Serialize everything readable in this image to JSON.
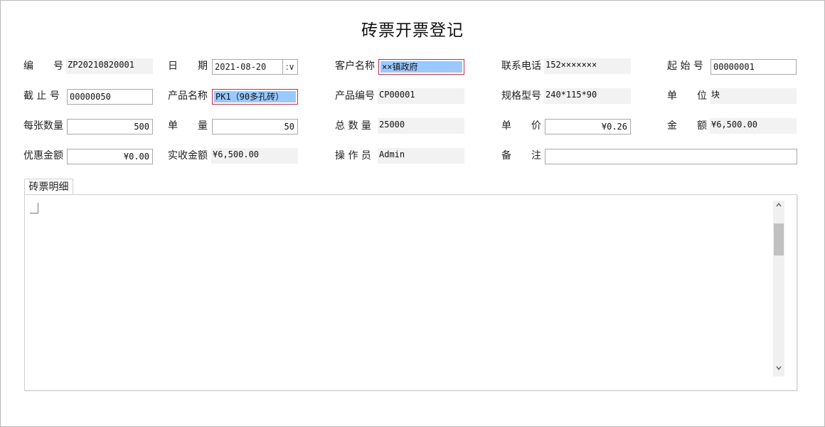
{
  "window": {
    "title": "砖票开票登记"
  },
  "form": {
    "row1": {
      "serial_label": "编　　号",
      "serial_value": "ZP20210820001",
      "date_label": "日　　期",
      "date_value": "2021-08-20",
      "date_spin": ":∨",
      "customer_label": "客户名称",
      "customer_value": "××镇政府",
      "phone_label": "联系电话",
      "phone_value": "152×××××××",
      "start_label": "起 始 号",
      "start_value": "00000001"
    },
    "row2": {
      "end_label": "截 止 号",
      "end_value": "00000050",
      "product_name_label": "产品名称",
      "product_name_value": "PK1（90多孔砖）",
      "product_code_label": "产品编号",
      "product_code_value": "CP00001",
      "spec_label": "规格型号",
      "spec_value": "240*115*90",
      "unit_label": "单　　位",
      "unit_value": "块"
    },
    "row3": {
      "per_sheet_label": "每张数量",
      "per_sheet_value": "500",
      "single_qty_label": "单　　量",
      "single_qty_value": "50",
      "total_qty_label": "总 数 量",
      "total_qty_value": "25000",
      "price_label": "单　　价",
      "price_value": "¥0.26",
      "amount_label": "金　　额",
      "amount_value": "¥6,500.00"
    },
    "row4": {
      "discount_label": "优惠金额",
      "discount_value": "¥0.00",
      "received_label": "实收金额",
      "received_value": "¥6,500.00",
      "operator_label": "操 作 员",
      "operator_value": "Admin",
      "remark_label": "备　　注",
      "remark_value": ""
    }
  },
  "detail_tab": {
    "label": "砖票明细"
  },
  "scrollbar": {
    "up_icon": "chevron-up-icon",
    "down_icon": "chevron-down-icon",
    "position": 0.1
  }
}
